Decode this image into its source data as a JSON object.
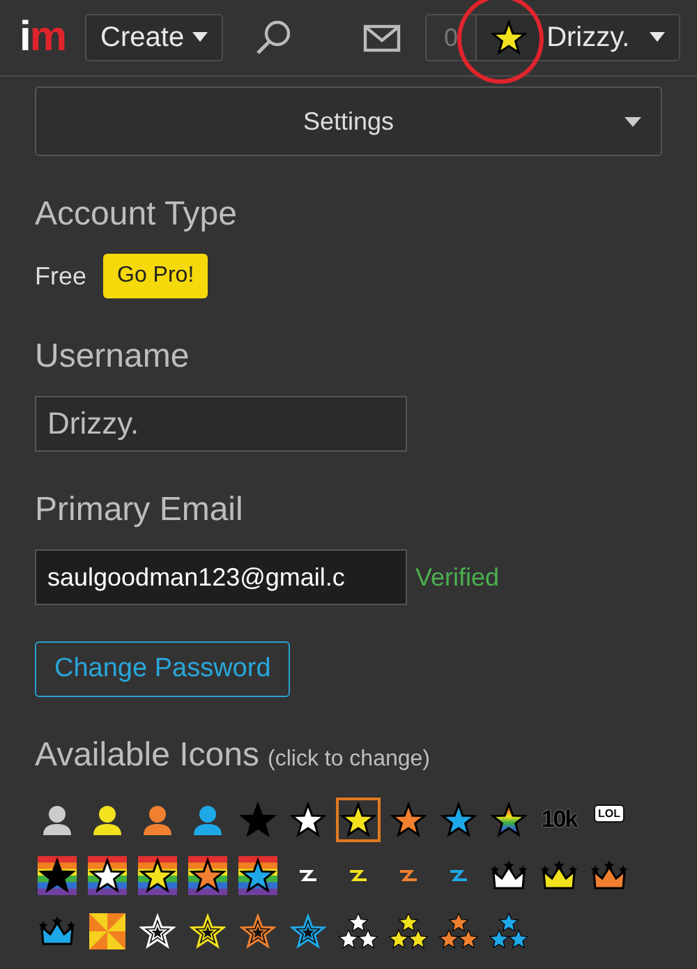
{
  "header": {
    "logo_letters": [
      "i",
      "m"
    ],
    "create": "Create",
    "notification_count": "0",
    "user": "Drizzy."
  },
  "settings_menu": {
    "label": "Settings"
  },
  "account_type": {
    "heading": "Account Type",
    "plan": "Free",
    "upgrade": "Go Pro!"
  },
  "username": {
    "heading": "Username",
    "value": "Drizzy."
  },
  "email": {
    "heading": "Primary Email",
    "value": "saulgoodman123@gmail.c",
    "status": "Verified"
  },
  "change_password": "Change Password",
  "icons": {
    "heading": "Available Icons",
    "hint": "(click to change)",
    "items": [
      {
        "kind": "person",
        "color": "#cccccc",
        "selected": false
      },
      {
        "kind": "person",
        "color": "#f2e21e",
        "selected": false
      },
      {
        "kind": "person",
        "color": "#f08030",
        "selected": false
      },
      {
        "kind": "person",
        "color": "#1fa8e8",
        "selected": false
      },
      {
        "kind": "star",
        "color": "#000000",
        "selected": false
      },
      {
        "kind": "star",
        "color": "#ffffff",
        "selected": false
      },
      {
        "kind": "star",
        "color": "#f2e21e",
        "selected": true
      },
      {
        "kind": "star",
        "color": "#f08030",
        "selected": false
      },
      {
        "kind": "star",
        "color": "#1fa8e8",
        "selected": false
      },
      {
        "kind": "stripedstar",
        "selected": false
      },
      {
        "kind": "text",
        "label": "10k",
        "selected": false
      },
      {
        "kind": "bubble",
        "label": "LOL",
        "selected": false
      },
      {
        "kind": "rainbowstar",
        "color": "#000000",
        "selected": false
      },
      {
        "kind": "rainbowstar",
        "color": "#ffffff",
        "selected": false
      },
      {
        "kind": "rainbowstar",
        "color": "#f2e21e",
        "selected": false
      },
      {
        "kind": "rainbowstar",
        "color": "#f08030",
        "selected": false
      },
      {
        "kind": "rainbowstar",
        "color": "#1fa8e8",
        "selected": false
      },
      {
        "kind": "bolt",
        "color": "#ffffff",
        "selected": false
      },
      {
        "kind": "bolt",
        "color": "#f2e21e",
        "selected": false
      },
      {
        "kind": "bolt",
        "color": "#f08030",
        "selected": false
      },
      {
        "kind": "bolt",
        "color": "#1fa8e8",
        "selected": false
      },
      {
        "kind": "crown",
        "color": "#ffffff",
        "selected": false
      },
      {
        "kind": "crown",
        "color": "#f2e21e",
        "selected": false
      },
      {
        "kind": "crown",
        "color": "#f08030",
        "selected": false
      },
      {
        "kind": "crown",
        "color": "#1fa8e8",
        "selected": false
      },
      {
        "kind": "burst",
        "selected": false
      },
      {
        "kind": "outlinestar",
        "color": "#ffffff",
        "selected": false
      },
      {
        "kind": "outlinestar",
        "color": "#f2e21e",
        "selected": false
      },
      {
        "kind": "outlinestar",
        "color": "#f08030",
        "selected": false
      },
      {
        "kind": "outlinestar",
        "color": "#1fa8e8",
        "selected": false
      },
      {
        "kind": "triplestar",
        "color": "#ffffff",
        "selected": false
      },
      {
        "kind": "triplestar",
        "color": "#f2e21e",
        "selected": false
      },
      {
        "kind": "triplestar",
        "color": "#f08030",
        "selected": false
      },
      {
        "kind": "triplestar",
        "color": "#1fa8e8",
        "selected": false
      }
    ]
  }
}
